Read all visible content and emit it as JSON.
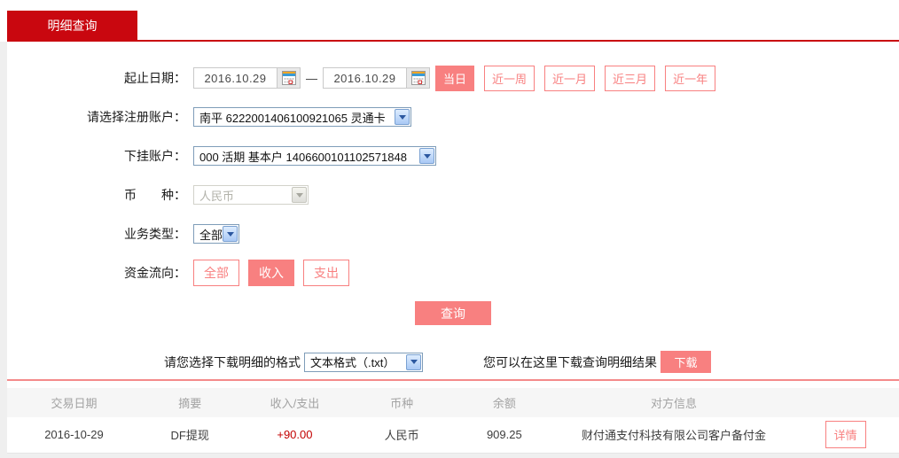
{
  "tab": {
    "label": "明细查询"
  },
  "form": {
    "date_range": {
      "label": "起止日期：",
      "start": "2016.10.29",
      "end": "2016.10.29",
      "separator": "—",
      "quick_buttons": [
        {
          "label": "当日"
        },
        {
          "label": "近一周"
        },
        {
          "label": "近一月"
        },
        {
          "label": "近三月"
        },
        {
          "label": "近一年"
        }
      ]
    },
    "register_account": {
      "label": "请选择注册账户：",
      "value": "南平 6222001406100921065 灵通卡"
    },
    "sub_account": {
      "label": "下挂账户：",
      "value": "000 活期 基本户 1406600101102571848"
    },
    "currency": {
      "label": "币　　种：",
      "value": "人民币"
    },
    "business_type": {
      "label": "业务类型：",
      "value": "全部"
    },
    "fund_flow": {
      "label": "资金流向：",
      "options": [
        {
          "label": "全部"
        },
        {
          "label": "收入"
        },
        {
          "label": "支出"
        }
      ]
    },
    "query_button": "查询"
  },
  "download": {
    "format_label": "请您选择下载明细的格式",
    "format_value": "文本格式（.txt）",
    "hint": "您可以在这里下载查询明细结果",
    "button": "下载"
  },
  "table": {
    "headers": [
      "交易日期",
      "摘要",
      "收入/支出",
      "币种",
      "余额",
      "对方信息"
    ],
    "rows": [
      {
        "date": "2016-10-29",
        "summary": "DF提现",
        "amount": "+90.00",
        "currency": "人民币",
        "balance": "909.25",
        "counterparty": "财付通支付科技有限公司客户备付金",
        "detail_label": "详情"
      }
    ]
  },
  "colors": {
    "brand_red": "#c9070f",
    "accent_salmon": "#f88080",
    "amount_red": "#c30000"
  }
}
